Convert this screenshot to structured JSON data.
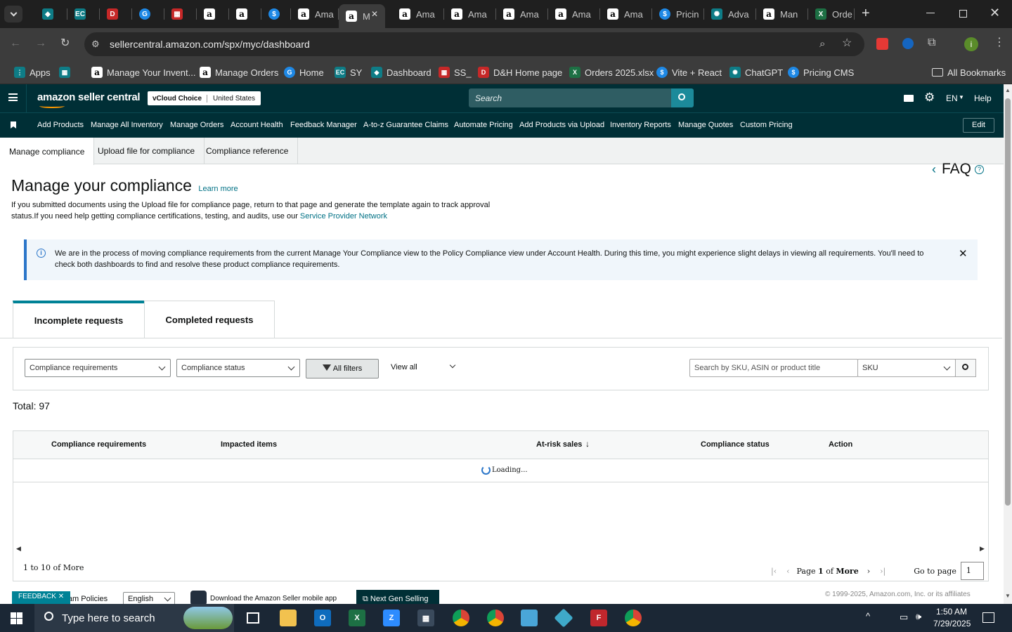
{
  "browser": {
    "tabs": [
      {
        "label": "",
        "icon": "teal-logo-icon"
      },
      {
        "label": "",
        "icon": "ec-logo-icon"
      },
      {
        "label": "",
        "icon": "dh-logo-icon"
      },
      {
        "label": "",
        "icon": "g-logo-icon"
      },
      {
        "label": "",
        "icon": "boxes-icon"
      },
      {
        "label": "",
        "icon": "amazon-icon"
      },
      {
        "label": "",
        "icon": "amazon-icon"
      },
      {
        "label": "",
        "icon": "dollar-icon"
      },
      {
        "label": "Ama",
        "icon": "amazon-icon"
      },
      {
        "label": "M",
        "icon": "amazon-icon",
        "active": true
      },
      {
        "label": "Ama",
        "icon": "amazon-icon"
      },
      {
        "label": "Ama",
        "icon": "amazon-icon"
      },
      {
        "label": "Ama",
        "icon": "amazon-icon"
      },
      {
        "label": "Ama",
        "icon": "amazon-icon"
      },
      {
        "label": "Ama",
        "icon": "amazon-icon"
      },
      {
        "label": "Pricin",
        "icon": "dollar-icon"
      },
      {
        "label": "Adva",
        "icon": "openai-icon"
      },
      {
        "label": "Man",
        "icon": "amazon-icon"
      },
      {
        "label": "Orde",
        "icon": "excel-icon"
      }
    ],
    "url": "sellercentral.amazon.com/spx/myc/dashboard",
    "bookmarks": [
      {
        "label": "Apps",
        "icon": "apps-grid-icon"
      },
      {
        "label": "",
        "icon": "grid-icon"
      },
      {
        "label": "Manage Your Invent...",
        "icon": "amazon-icon"
      },
      {
        "label": "Manage Orders",
        "icon": "amazon-icon"
      },
      {
        "label": "Home",
        "icon": "g-logo-icon"
      },
      {
        "label": "SY",
        "icon": "ec-logo-icon"
      },
      {
        "label": "Dashboard",
        "icon": "teal-logo-icon"
      },
      {
        "label": "SS_",
        "icon": "boxes-icon"
      },
      {
        "label": "D&H Home page",
        "icon": "dh-logo-icon"
      },
      {
        "label": "Orders 2025.xlsx",
        "icon": "excel-icon"
      },
      {
        "label": "Vite + React",
        "icon": "dollar-icon"
      },
      {
        "label": "ChatGPT",
        "icon": "openai-icon"
      },
      {
        "label": "Pricing CMS",
        "icon": "dollar-icon"
      }
    ],
    "all_bookmarks": "All Bookmarks",
    "profile_initial": "i"
  },
  "header": {
    "logo": "amazon seller central",
    "store_name": "vCloud Choice",
    "marketplace": "United States",
    "search_placeholder": "Search",
    "language": "EN",
    "help": "Help"
  },
  "nav": {
    "links": [
      "Add Products",
      "Manage All Inventory",
      "Manage Orders",
      "Account Health",
      "Feedback Manager",
      "A-to-z Guarantee Claims",
      "Automate Pricing",
      "Add Products via Upload",
      "Inventory Reports",
      "Manage Quotes",
      "Custom Pricing"
    ],
    "edit": "Edit"
  },
  "subtabs": [
    "Manage compliance",
    "Upload file for compliance",
    "Compliance reference"
  ],
  "page": {
    "faq": "FAQ",
    "title": "Manage your compliance",
    "learn_more": "Learn more",
    "intro": "If you submitted documents using the Upload file for compliance page, return to that page and generate the template again to track approval status.If you need help getting compliance certifications, testing, and audits, use our",
    "intro_link": "Service Provider Network",
    "banner": "We are in the process of moving compliance requirements from the current Manage Your Compliance view to the Policy Compliance view under Account Health. During this time, you might experience slight delays in viewing all requirements. You'll need to check both dashboards to find and resolve these product compliance requirements.",
    "request_tabs": [
      "Incomplete requests",
      "Completed requests"
    ],
    "filters": {
      "requirements": "Compliance requirements",
      "status": "Compliance status",
      "all_filters": "All filters",
      "view_all": "View all",
      "search_placeholder": "Search by SKU, ASIN or product title",
      "search_type": "SKU"
    },
    "total": "Total: 97",
    "columns": [
      "Compliance requirements",
      "Impacted items",
      "At-risk sales",
      "Compliance status",
      "Action"
    ],
    "loading": "Loading...",
    "range": "1 to 10 of More",
    "pagination": {
      "page_label": "Page",
      "page": "1",
      "of": "of",
      "more": "More",
      "goto": "Go to page",
      "goto_value": "1"
    }
  },
  "footer": {
    "feedback": "FEEDBACK",
    "program_policies": "Program Policies",
    "language": "English",
    "mobile_app": "Download the Amazon Seller mobile app",
    "next_gen": "Next Gen Selling",
    "copyright": "© 1999-2025, Amazon.com, Inc. or its affiliates"
  },
  "taskbar": {
    "search_placeholder": "Type here to search",
    "time": "1:50 AM",
    "date": "7/29/2025"
  }
}
